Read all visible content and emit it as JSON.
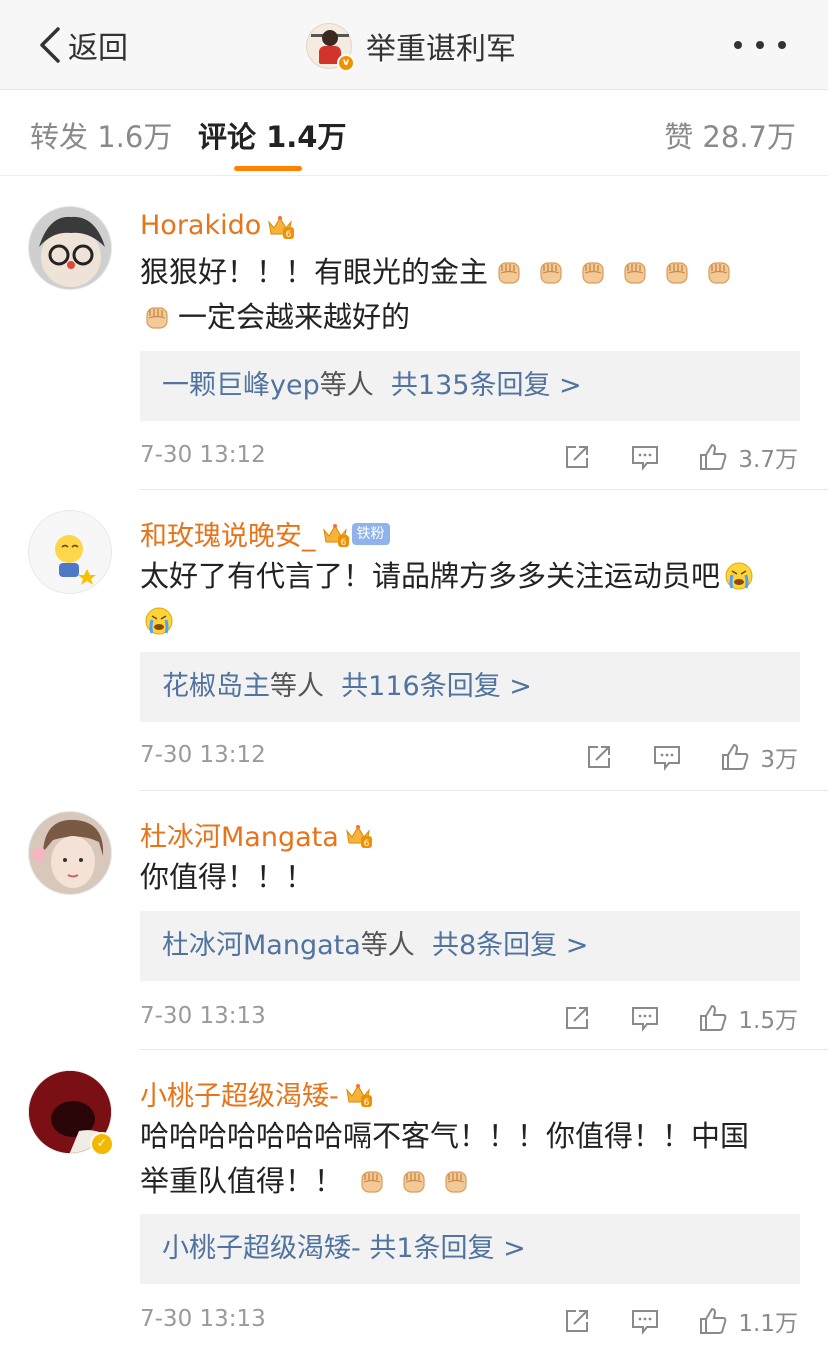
{
  "navbar": {
    "back_label": "返回",
    "account_name": "举重谌利军",
    "verified_badge": "v"
  },
  "tabs": {
    "repost": "转发 1.6万",
    "comment": "评论 1.4万",
    "like": "赞 28.7万",
    "active_color": "#ff8200"
  },
  "comments": [
    {
      "username": "Horakido",
      "text_parts": [
        "狠狠好！！！有眼光的金主",
        "一定会越来越好的"
      ],
      "reply_users": "一颗巨峰yep",
      "reply_mid": "等人",
      "reply_count": "共135条回复 >",
      "time": "7-30 13:12",
      "likes": "3.7万"
    },
    {
      "username": "和玫瑰说晚安_",
      "fan_badge": "铁粉",
      "text_parts": [
        "太好了有代言了！请品牌方多多关注运动员吧"
      ],
      "reply_users": "花椒岛主",
      "reply_mid": "等人",
      "reply_count": "共116条回复 >",
      "time": "7-30 13:12",
      "likes": "3万"
    },
    {
      "username": "杜冰河Mangata",
      "text_parts": [
        "你值得！！！"
      ],
      "reply_users": "杜冰河Mangata",
      "reply_mid": "等人",
      "reply_count": "共8条回复 >",
      "time": "7-30 13:13",
      "likes": "1.5万"
    },
    {
      "username": "小桃子超级渴矮-",
      "text_parts": [
        "哈哈哈哈哈哈哈嗝不客气！！！你值得！！中国",
        "举重队值得！！"
      ],
      "reply_users": "小桃子超级渴矮-",
      "reply_mid": "",
      "reply_count": "共1条回复 >",
      "time": "7-30 13:13",
      "likes": "1.1万"
    }
  ],
  "colors": {
    "username": "#e8741a",
    "link": "#5073a0",
    "reply_bg": "#f2f2f2"
  },
  "icons": [
    "chevron-left-icon",
    "more-dots-icon",
    "crown-icon",
    "fist-emoji-icon",
    "crying-emoji-icon",
    "share-icon",
    "comment-icon",
    "thumbs-up-icon"
  ]
}
